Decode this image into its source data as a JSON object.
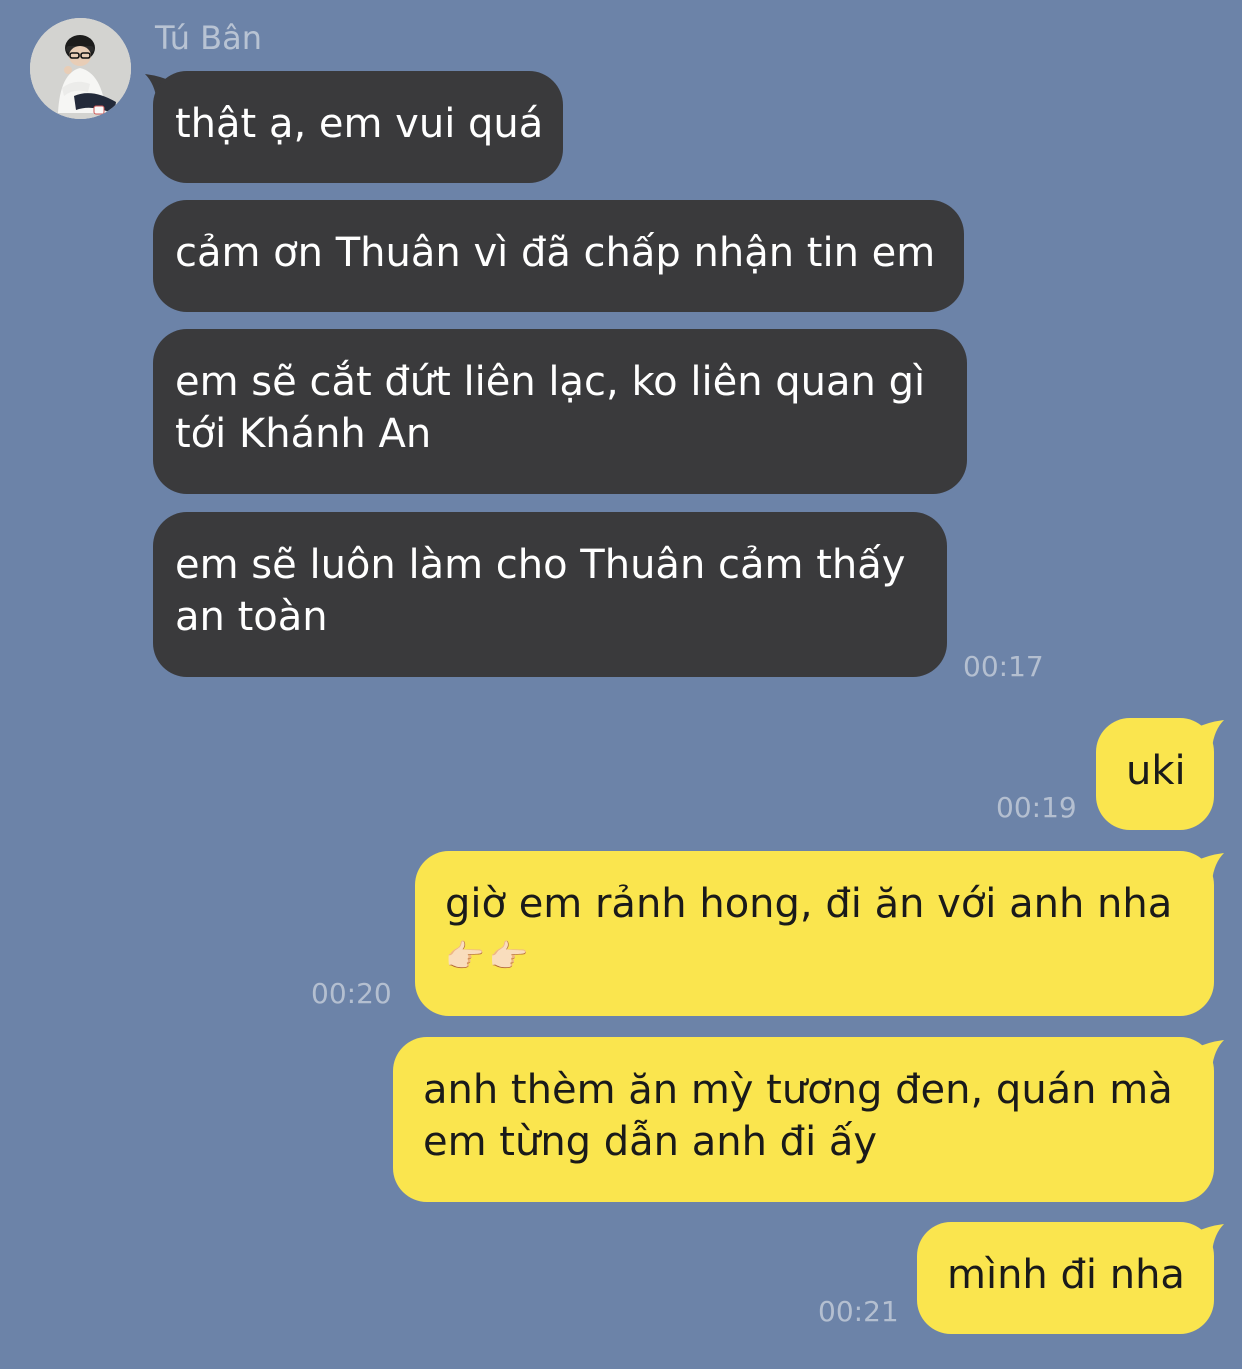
{
  "contact": {
    "name": "Tú Bân"
  },
  "colors": {
    "background": "#6c83a8",
    "incoming_bubble": "#3a3a3c",
    "outgoing_bubble": "#fae54e",
    "timestamp": "#b4bfd0"
  },
  "incoming": [
    {
      "line1": "thật ạ, em vui quá"
    },
    {
      "line1": "cảm ơn Thuân vì đã chấp nhận tin em"
    },
    {
      "line1": "em sẽ cắt đứt liên lạc, ko liên quan gì",
      "line2": "tới Khánh An"
    },
    {
      "line1": "em sẽ luôn làm cho Thuân cảm thấy",
      "line2": "an toàn",
      "time": "00:17"
    }
  ],
  "outgoing": [
    {
      "line1": "uki",
      "time": "00:19"
    },
    {
      "line1": "giờ em rảnh hong, đi ăn với anh nha",
      "emoji": "👉🏻👉🏻",
      "time": "00:20"
    },
    {
      "line1": "anh thèm ăn mỳ tương đen, quán mà",
      "line2": "em từng dẫn anh đi ấy"
    },
    {
      "line1": "mình đi nha",
      "time": "00:21"
    }
  ]
}
